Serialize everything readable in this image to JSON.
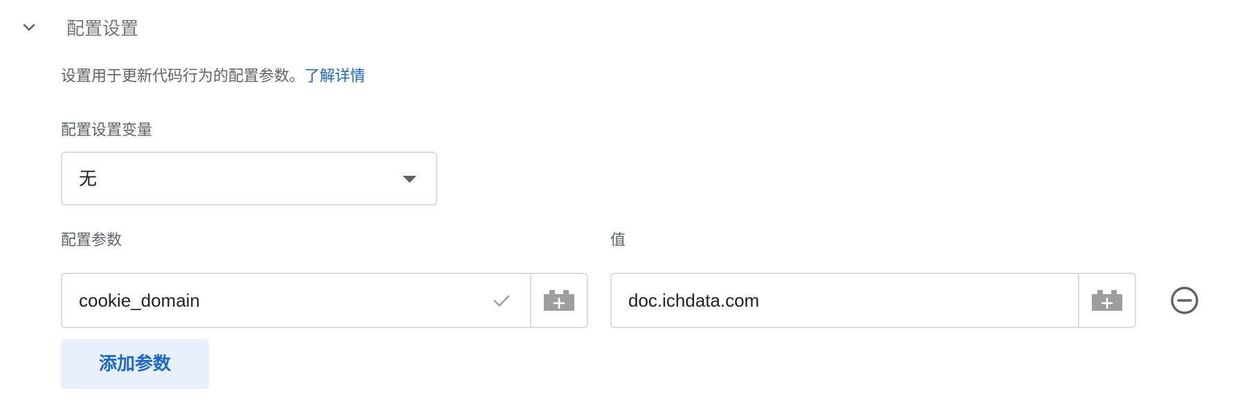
{
  "section": {
    "title": "配置设置",
    "description": "设置用于更新代码行为的配置参数。",
    "learn_more": "了解详情"
  },
  "config_variable": {
    "label": "配置设置变量",
    "selected": "无"
  },
  "parameters": {
    "name_label": "配置参数",
    "value_label": "值",
    "rows": [
      {
        "name": "cookie_domain",
        "value": "doc.ichdata.com"
      }
    ],
    "add_button": "添加参数"
  },
  "icons": {
    "collapse": "chevron-down-icon",
    "valid": "check-icon",
    "variable": "variable-block-icon",
    "remove": "remove-circle-icon"
  },
  "colors": {
    "link": "#1967d2",
    "button_bg": "#e8f0fe",
    "border": "#dadce0"
  }
}
